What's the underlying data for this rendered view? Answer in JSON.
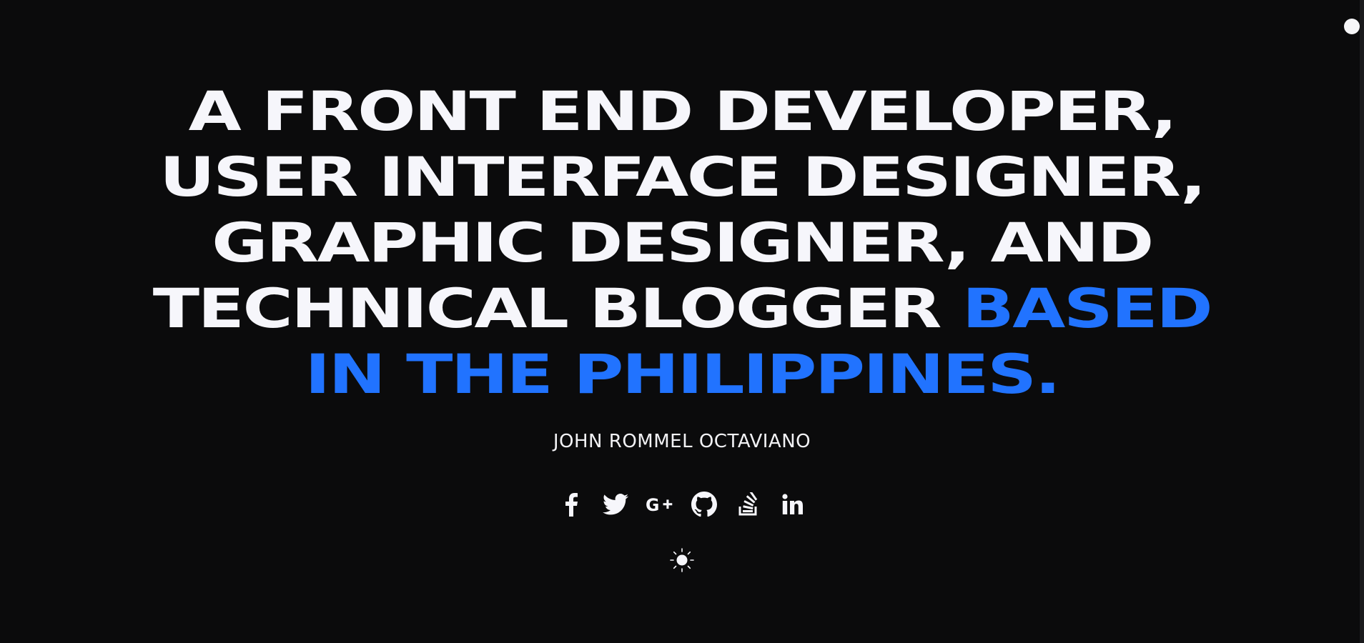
{
  "hero": {
    "headline_lines": [
      "A FRONT END DEVELOPER,",
      "USER INTERFACE DESIGNER,",
      "GRAPHIC DESIGNER, AND",
      "TECHNICAL BLOGGER"
    ],
    "accent_inline": "BASED",
    "accent_line": "IN THE PHILIPPINES.",
    "name": "JOHN ROMMEL OCTAVIANO"
  },
  "socials": [
    {
      "icon": "facebook-icon"
    },
    {
      "icon": "twitter-icon"
    },
    {
      "icon": "google-plus-icon"
    },
    {
      "icon": "github-icon"
    },
    {
      "icon": "stackoverflow-icon"
    },
    {
      "icon": "linkedin-icon"
    }
  ],
  "theme": {
    "icon": "sun-icon"
  },
  "colors": {
    "background": "#0b0b0c",
    "text": "#f6f6fb",
    "accent": "#2173ff"
  }
}
